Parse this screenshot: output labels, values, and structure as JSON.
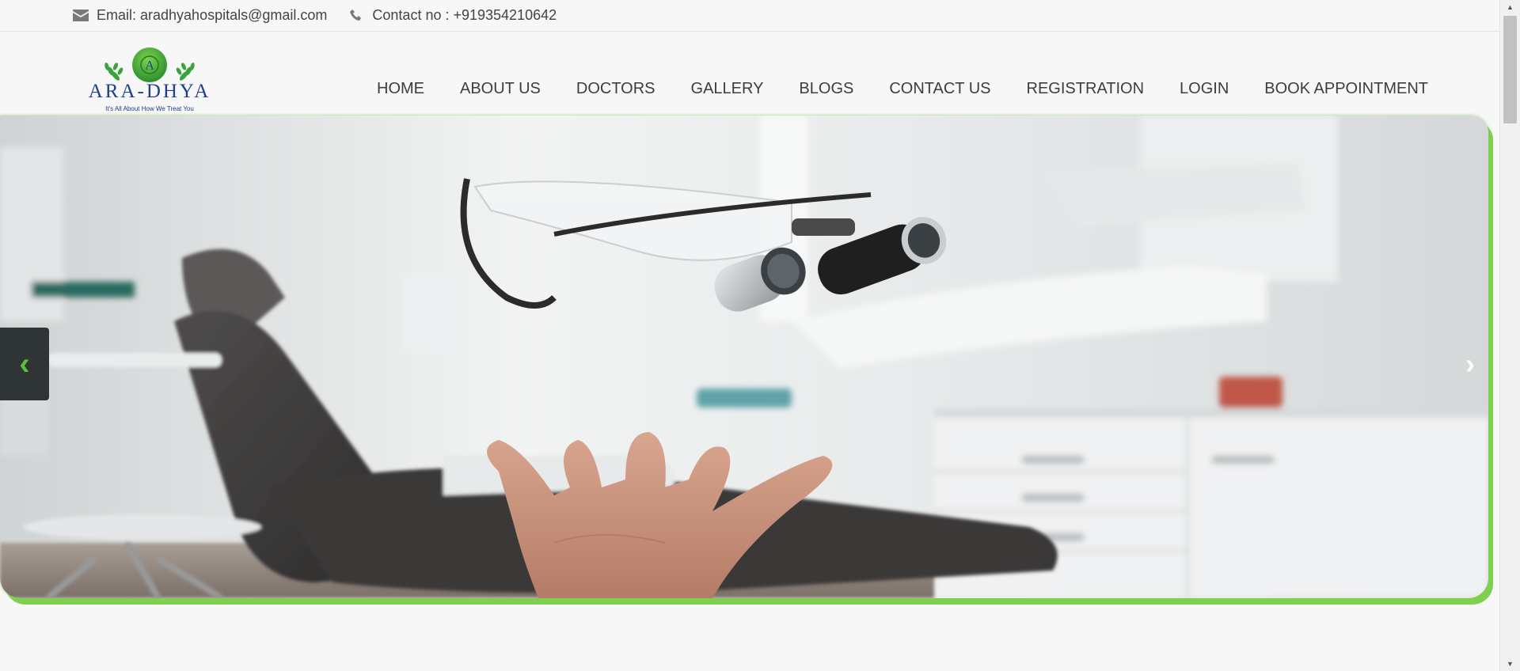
{
  "contact_bar": {
    "email": "Email: aradhyahospitals@gmail.com",
    "phone": "Contact no : +919354210642"
  },
  "logo": {
    "letter": "A",
    "name": "ARA-DHYA",
    "tagline": "It's All About How We Treat You"
  },
  "nav": {
    "items": [
      {
        "label": "HOME"
      },
      {
        "label": "ABOUT US"
      },
      {
        "label": "DOCTORS"
      },
      {
        "label": "GALLERY"
      },
      {
        "label": "BLOGS"
      },
      {
        "label": "CONTACT US"
      },
      {
        "label": "REGISTRATION"
      },
      {
        "label": "LOGIN"
      },
      {
        "label": "BOOK APPOINTMENT"
      }
    ]
  },
  "slider": {
    "prev_icon": "chevron-left-icon",
    "next_icon": "chevron-right-icon",
    "prev_glyph": "‹",
    "next_glyph": "›"
  },
  "colors": {
    "accent_green": "#7ed04f",
    "logo_blue": "#1c3e8c",
    "logo_green": "#3aa33b"
  }
}
